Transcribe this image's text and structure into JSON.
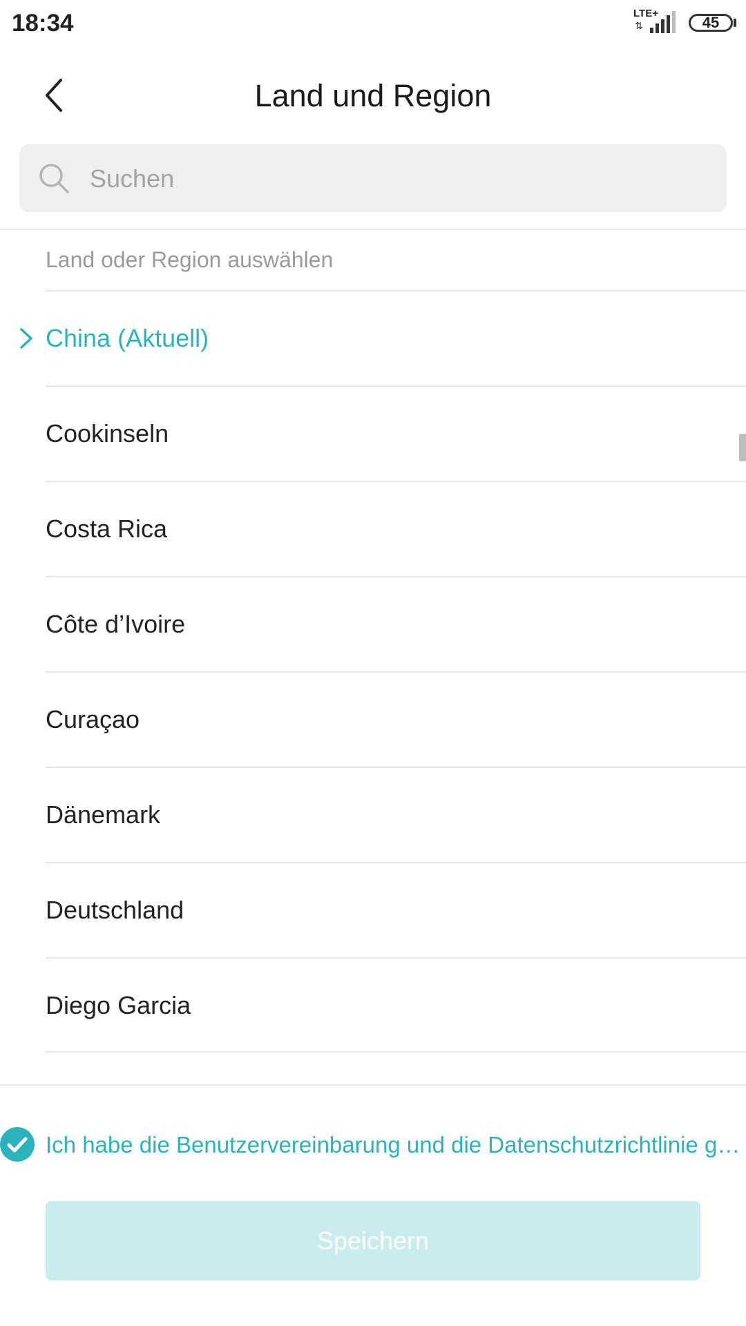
{
  "status_bar": {
    "time": "18:34",
    "network_type": "LTE+",
    "battery": "45"
  },
  "header": {
    "title": "Land und Region",
    "back_icon": "chevron-left-icon"
  },
  "search": {
    "placeholder": "Suchen",
    "value": "",
    "icon": "search-icon"
  },
  "section_label": "Land oder Region auswählen",
  "countries": [
    {
      "label": "China (Aktuell)",
      "current": true
    },
    {
      "label": "Cookinseln",
      "current": false
    },
    {
      "label": "Costa Rica",
      "current": false
    },
    {
      "label": "Côte d’Ivoire",
      "current": false
    },
    {
      "label": "Curaçao",
      "current": false
    },
    {
      "label": "Dänemark",
      "current": false
    },
    {
      "label": "Deutschland",
      "current": false
    },
    {
      "label": "Diego Garcia",
      "current": false
    }
  ],
  "agreement": {
    "checked": true,
    "text": "Ich habe die Benutzervereinbarung und die Datenschutzrichtlinie ge…"
  },
  "save_button": {
    "label": "Speichern",
    "enabled": false
  },
  "colors": {
    "accent": "#2ab3bd",
    "button_disabled": "#c9ecee",
    "search_bg": "#efefef"
  }
}
